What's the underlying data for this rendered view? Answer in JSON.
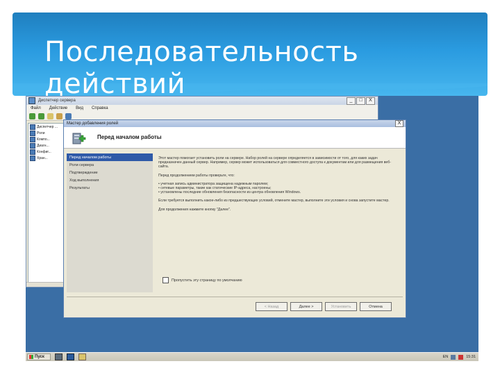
{
  "slide": {
    "title": "Последовательность действий"
  },
  "server_manager": {
    "title": "Диспетчер сервера",
    "menu": [
      "Файл",
      "Действие",
      "Вид",
      "Справка"
    ],
    "tree": [
      "Диспетчер ...",
      "Роли",
      "Компо...",
      "Диагн...",
      "Конфиг...",
      "Хран..."
    ],
    "window_controls": [
      "_",
      "□",
      "X"
    ]
  },
  "wizard": {
    "title": "Мастер добавления ролей",
    "close": "X",
    "header_title": "Перед началом работы",
    "nav_items": [
      "Перед началом работы",
      "Роли сервера",
      "Подтверждение",
      "Ход выполнения",
      "Результаты"
    ],
    "content": {
      "p1": "Этот мастер помогает установить роли на сервере. Набор ролей на сервере определяется в зависимости от того, для каких задач предназначен данный сервер. Например, сервер может использоваться для совместного доступа к документам или для размещения веб-сайта.",
      "p2": "Перед продолжением работы проверьте, что:",
      "bullets": [
        "• учетная запись администратора защищена надежным паролем;",
        "• сетевые параметры, такие как статические IP-адреса, настроены;",
        "• установлены последние обновления безопасности из центра обновления Windows."
      ],
      "p3": "Если требуется выполнить какое-либо из предшествующих условий, отмените мастер, выполните эти условия и снова запустите мастер.",
      "p4": "Для продолжения нажмите кнопку \"Далее\"."
    },
    "skip_checkbox_label": "Пропустить эту страницу по умолчанию",
    "buttons": {
      "back": "< Назад",
      "next": "Далее >",
      "install": "Установить",
      "cancel": "Отмена"
    }
  },
  "taskbar": {
    "start_label": "Пуск",
    "tray_lang": "EN",
    "clock": "15:31"
  },
  "colors": {
    "header_blue": "#2a9be0",
    "desktop_blue": "#3a6ea5",
    "nav_selected": "#2f5aa8"
  }
}
